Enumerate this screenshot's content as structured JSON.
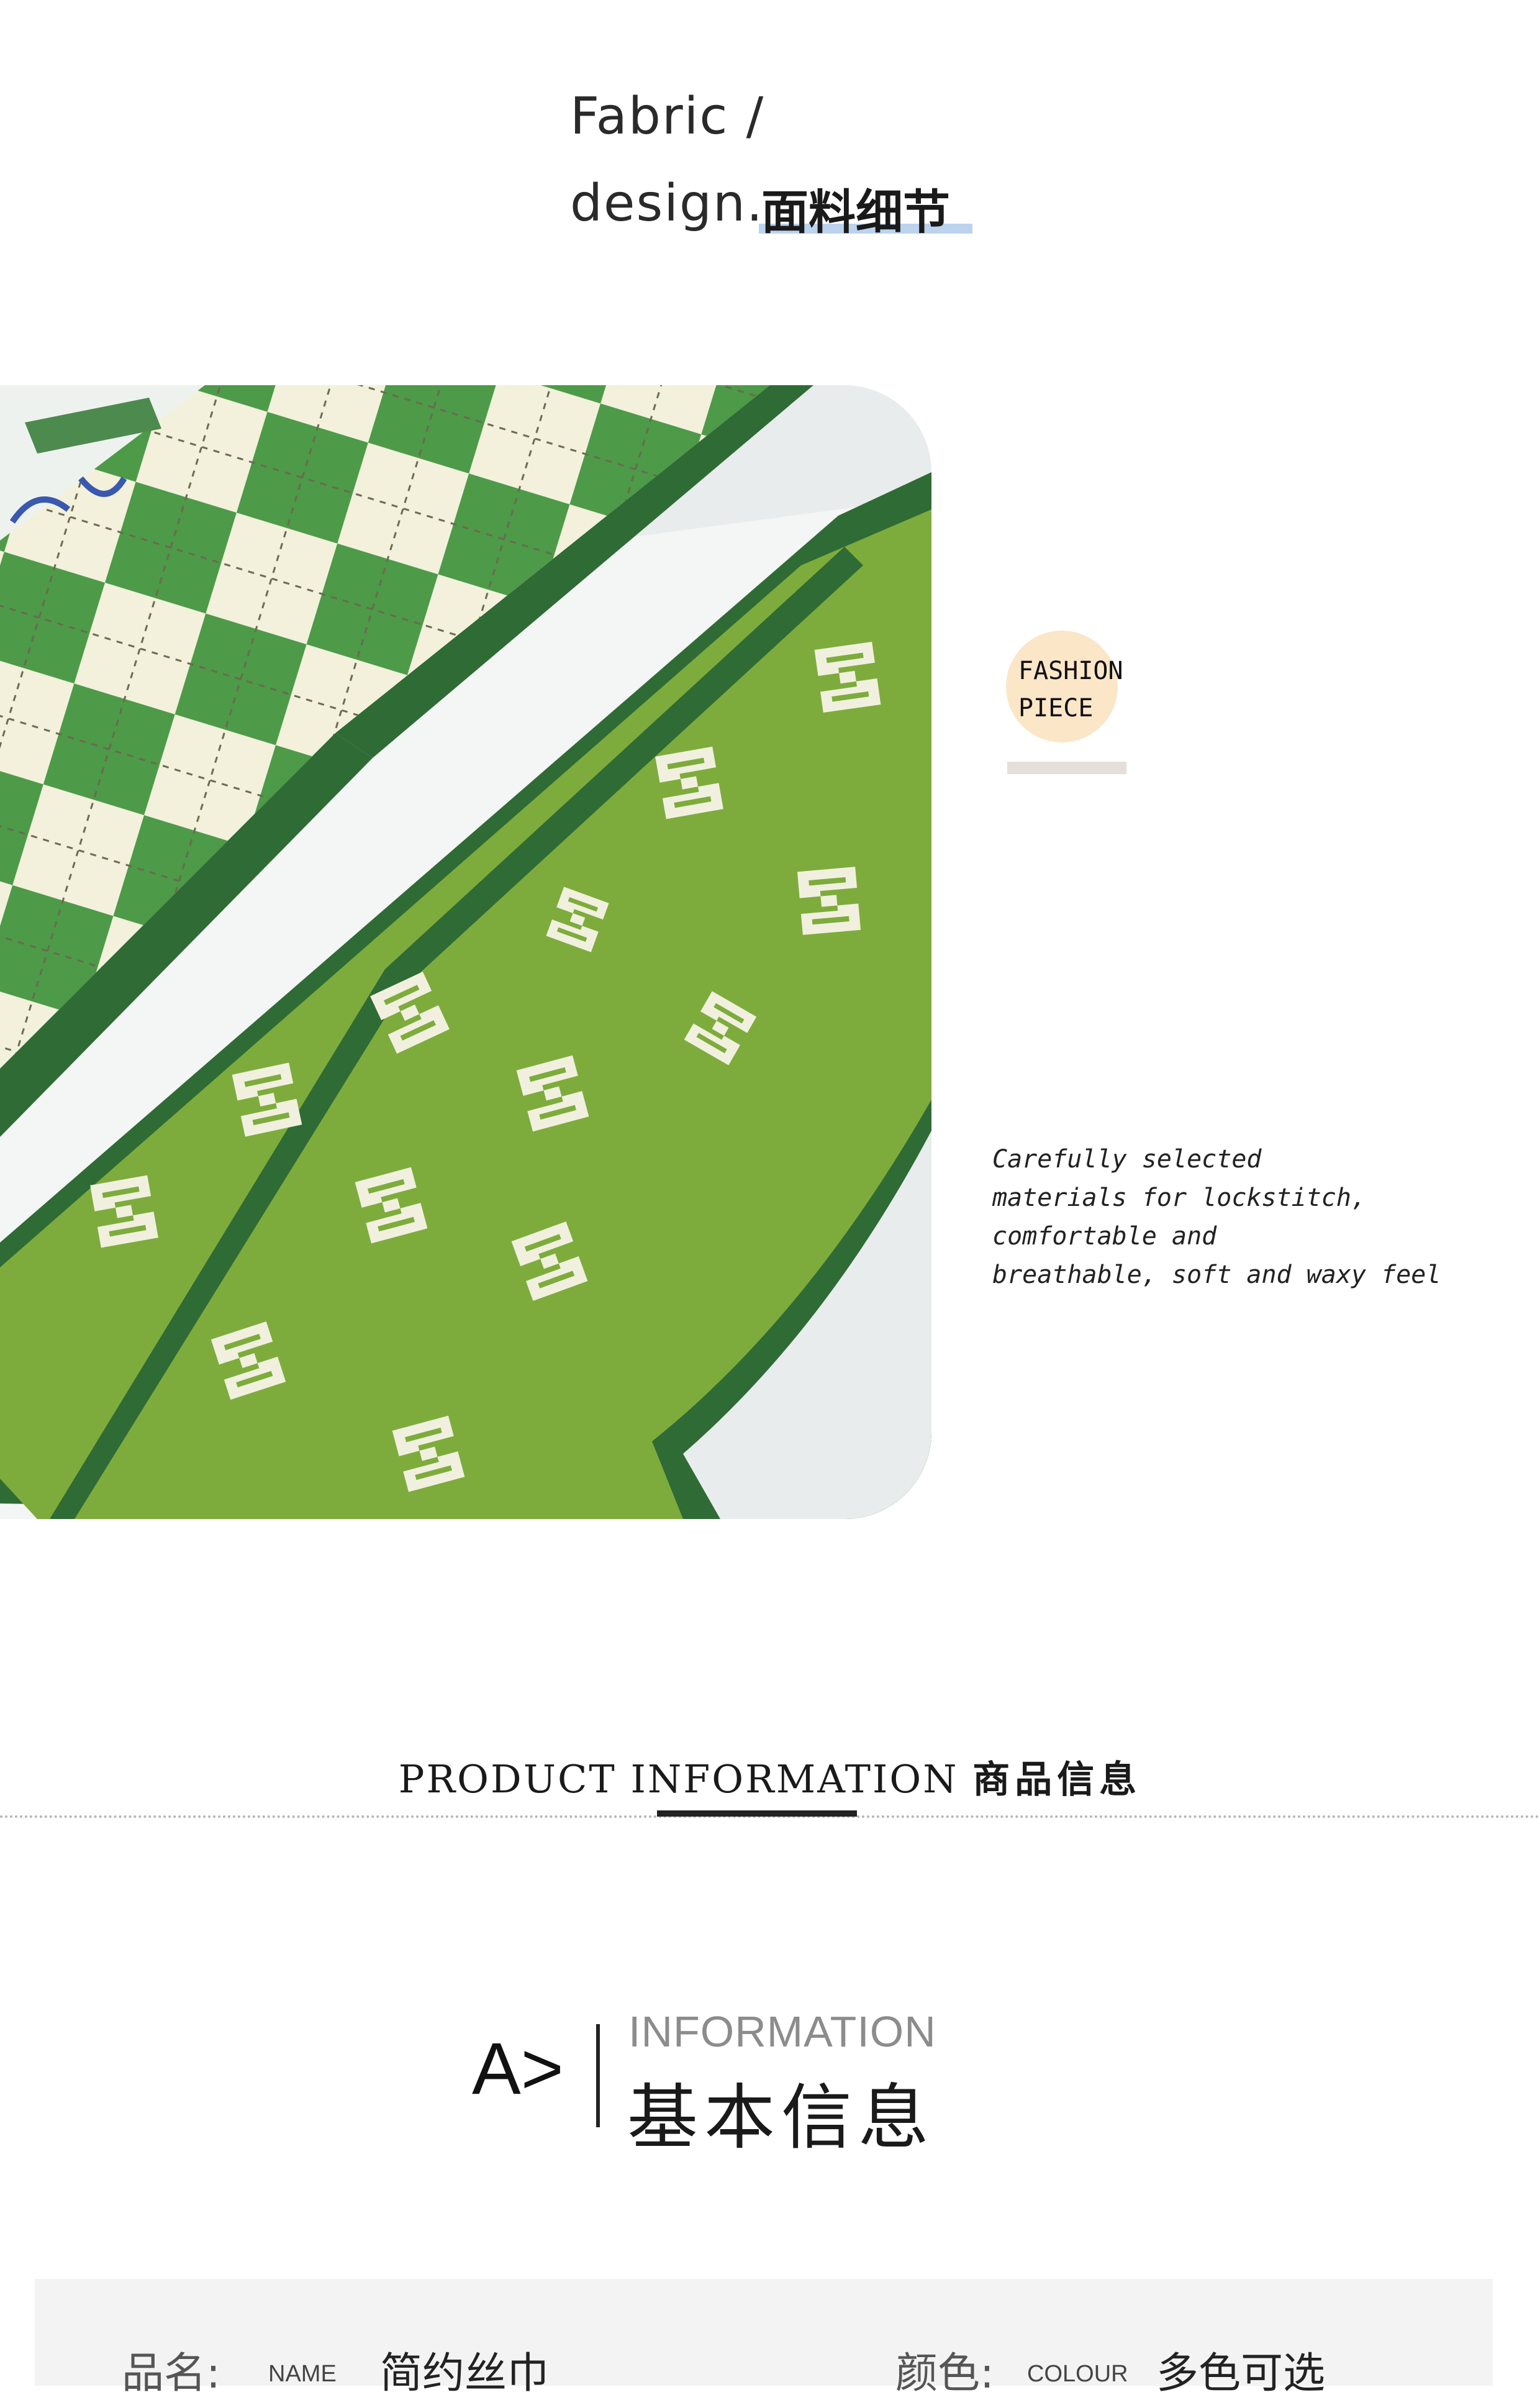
{
  "fabric": {
    "line1": "Fabric /",
    "line2": "design.",
    "title_cn": "面料细节"
  },
  "fashion_badge": {
    "line1": "FASHION",
    "line2": "PIECE"
  },
  "care_text": "Carefully selected\nmaterials for lockstitch,\ncomfortable and\nbreathable, soft and waxy feel",
  "product_info": {
    "title_en": "PRODUCT INFORMATION",
    "title_cn": "商品信息"
  },
  "basic_info": {
    "prefix": "A>",
    "title_en": "INFORMATION",
    "title_cn": "基本信息"
  },
  "specs": {
    "name_label": "品名:",
    "name_en": "NAME",
    "name_value": "简约丝巾",
    "colour_label": "颜色:",
    "colour_en": "COLOUR",
    "colour_value": "多色可选"
  },
  "colors": {
    "scarf_green": "#7dac3c",
    "scarf_dark_green": "#2f6b35",
    "scarf_cream": "#f3f1dc",
    "badge_circle": "#fbe6c8",
    "accent_underline": "#bcd3ee"
  }
}
